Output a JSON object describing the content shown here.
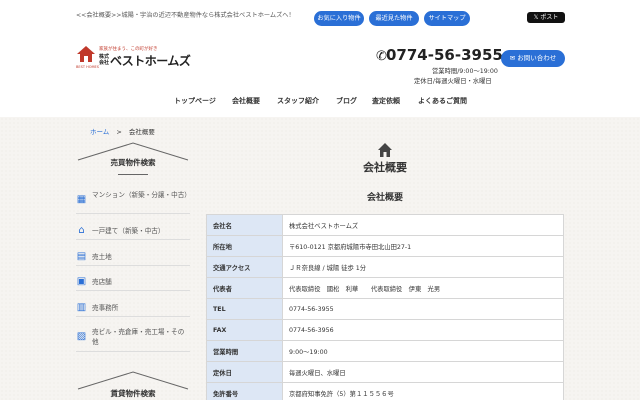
{
  "header": {
    "breadcrumb_text": "<<会社概要>>城陽・宇治の近辺不動産物件なら株式会社ベストホームズへ！",
    "favorites_label": "お気に入り物件",
    "recent_label": "最近見た物件",
    "sitemap_label": "サイトマップ",
    "x_post_label": "𝕏 ポスト",
    "logo": {
      "tagline": "家族が住まう、この町が好き",
      "kabushiki": "株式会社",
      "name": "ベストホームズ",
      "sub": "BEST HOMES"
    },
    "phone": "0774-56-3955",
    "hours": "営業時間/9:00～19:00",
    "closed": "定休日/毎週火曜日・水曜日",
    "contact_label": "お問い合わせ"
  },
  "nav": {
    "items": [
      "トップページ",
      "会社概要",
      "スタッフ紹介",
      "ブログ",
      "査定依頼",
      "よくあるご質問"
    ]
  },
  "breadcrumb": {
    "home": "ホーム",
    "sep": ">",
    "current": "会社概要"
  },
  "sidebar": {
    "sale_title": "売買物件検索",
    "sale_items": [
      {
        "label": "マンション（新築・分譲・中古）",
        "icon": "building-icon"
      },
      {
        "label": "一戸建て（新築・中古）",
        "icon": "house-icon"
      },
      {
        "label": "売土地",
        "icon": "land-icon"
      },
      {
        "label": "売店舗",
        "icon": "store-icon"
      },
      {
        "label": "売事務所",
        "icon": "office-icon"
      },
      {
        "label": "売ビル・売倉庫・売工場・その他",
        "icon": "warehouse-icon"
      }
    ],
    "rent_title": "賃貸物件検索"
  },
  "main": {
    "title": "会社概要",
    "subtitle": "会社概要",
    "rows": [
      {
        "key": "会社名",
        "value": "株式会社ベストホームズ"
      },
      {
        "key": "所在地",
        "value": "〒610-0121 京都府城陽市寺田北山田27-1"
      },
      {
        "key": "交通アクセス",
        "value": "ＪＲ奈良線 / 城陽 徒歩 1分"
      },
      {
        "key": "代表者",
        "value": "代表取締役　國松　利華　　代表取締役　伊東　光男"
      },
      {
        "key": "TEL",
        "value": "0774-56-3955"
      },
      {
        "key": "FAX",
        "value": "0774-56-3956"
      },
      {
        "key": "営業時間",
        "value": "9:00～19:00"
      },
      {
        "key": "定休日",
        "value": "毎週火曜日、水曜日"
      },
      {
        "key": "免許番号",
        "value": "京都府知事免許（5）第１１５５６号"
      }
    ]
  },
  "colors": {
    "accent": "#2a6fd6",
    "table_key_bg": "#dde7f5",
    "logo_red": "#c0392b"
  }
}
